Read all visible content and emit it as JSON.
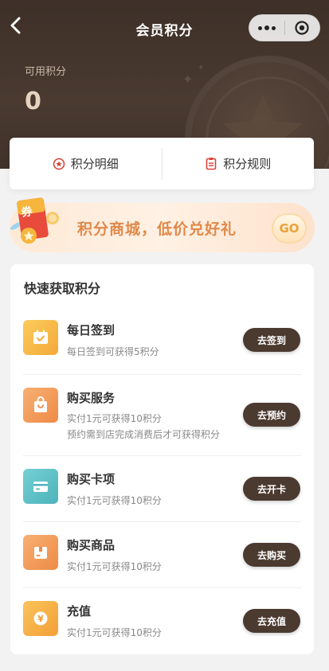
{
  "nav": {
    "title": "会员积分"
  },
  "points": {
    "label": "可用积分",
    "value": "0"
  },
  "tabs": [
    {
      "label": "积分明细",
      "icon": "star-circle-icon"
    },
    {
      "label": "积分规则",
      "icon": "clipboard-icon"
    }
  ],
  "banner": {
    "text": "积分商城，低价兑好礼",
    "go_label": "GO",
    "coupon_text": "券"
  },
  "tasks": {
    "title": "快速获取积分",
    "items": [
      {
        "name": "每日签到",
        "desc1": "每日签到可获得5积分",
        "desc2": "",
        "button": "去签到",
        "icon": "calendar-check-icon",
        "color": "#f6b73c"
      },
      {
        "name": "购买服务",
        "desc1": "实付1元可获得10积分",
        "desc2": "预约需到店完成消费后才可获得积分",
        "button": "去预约",
        "icon": "shopping-bag-icon",
        "color": "#f19a4e"
      },
      {
        "name": "购买卡项",
        "desc1": "实付1元可获得10积分",
        "desc2": "",
        "button": "去开卡",
        "icon": "card-icon",
        "color": "#5fc3c9"
      },
      {
        "name": "购买商品",
        "desc1": "实付1元可获得10积分",
        "desc2": "",
        "button": "去购买",
        "icon": "box-icon",
        "color": "#f19a4e"
      },
      {
        "name": "充值",
        "desc1": "实付1元可获得10积分",
        "desc2": "",
        "button": "去充值",
        "icon": "yuan-coin-icon",
        "color": "#f6b03c"
      }
    ]
  },
  "colors": {
    "header_bg": "#3d3028",
    "button_bg": "#4b3a30",
    "banner_text": "#e0894a",
    "accent_red": "#d9443b"
  }
}
